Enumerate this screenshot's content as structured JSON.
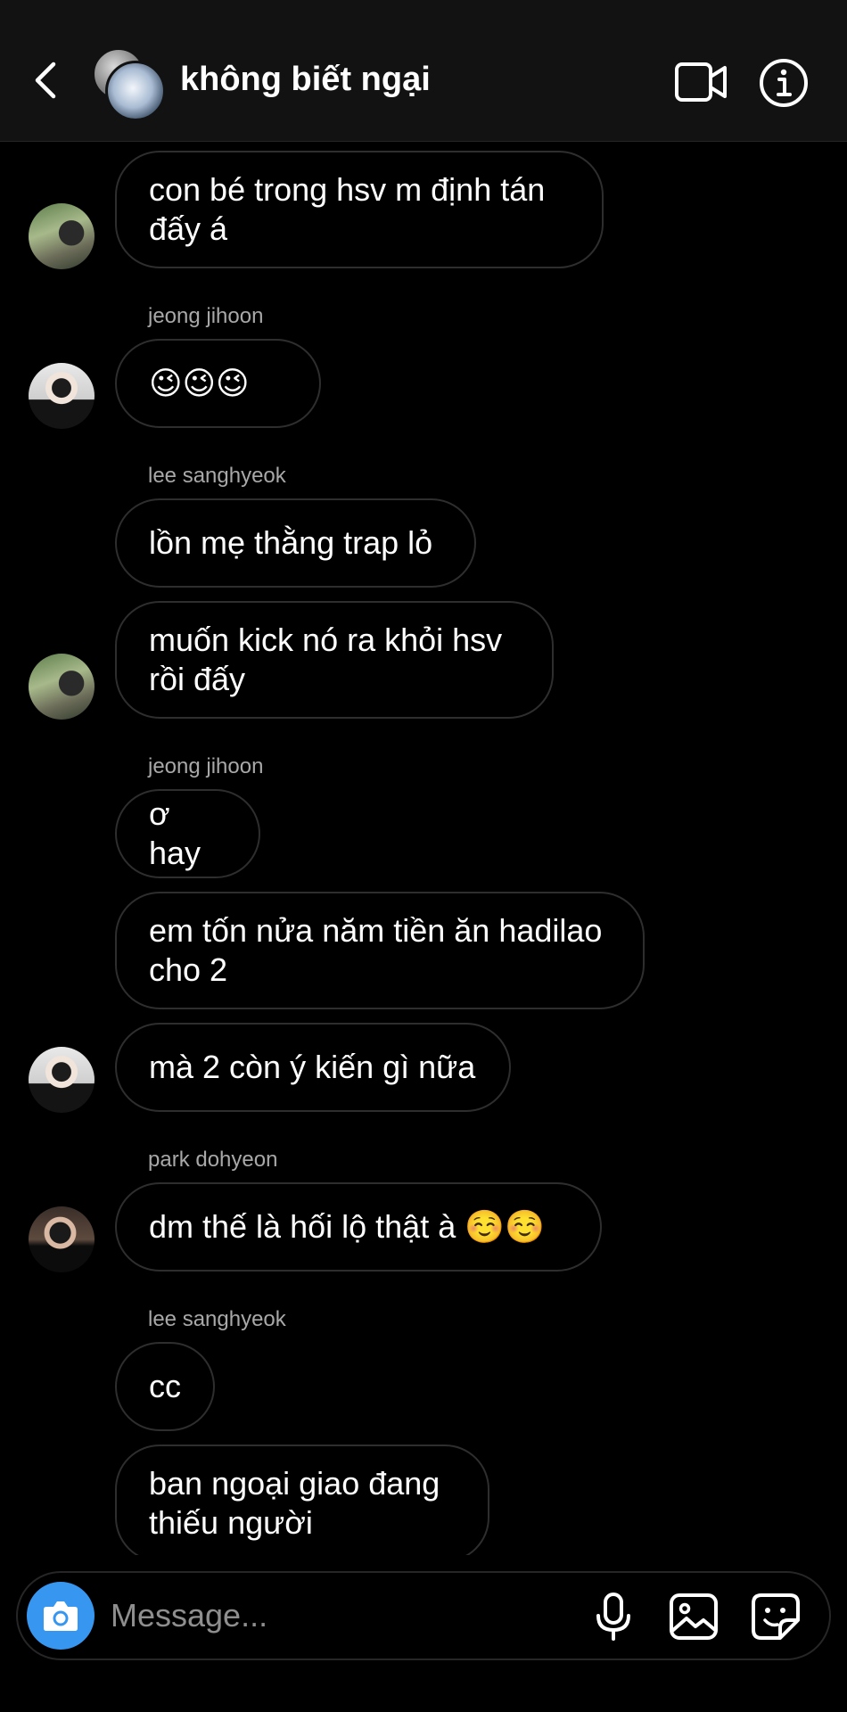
{
  "header": {
    "title": "không biết ngại",
    "back_icon": "chevron-left-icon",
    "video_icon": "video-camera-icon",
    "info_icon": "info-icon"
  },
  "messages": [
    {
      "sender": "",
      "text": "con bé trong hsv m định tán đấy á"
    },
    {
      "sender": "jeong jihoon",
      "text": "😉😉😉"
    },
    {
      "sender": "lee sanghyeok",
      "text": "lồn mẹ thằng trap lỏ"
    },
    {
      "sender": "",
      "text": "muốn kick nó ra khỏi hsv rồi đấy"
    },
    {
      "sender": "jeong jihoon",
      "text": "ơ hay"
    },
    {
      "sender": "",
      "text": "em tốn nửa năm tiền ăn hadilao cho 2"
    },
    {
      "sender": "",
      "text": "mà 2 còn ý kiến gì nữa"
    },
    {
      "sender": "park dohyeon",
      "text": "dm thế là hối lộ thật à ☺️☺️"
    },
    {
      "sender": "lee sanghyeok",
      "text": "cc"
    },
    {
      "sender": "",
      "text": "ban ngoại giao đang thiếu người"
    }
  ],
  "composer": {
    "placeholder": "Message...",
    "value": "",
    "camera_icon": "camera-icon",
    "mic_icon": "microphone-icon",
    "gallery_icon": "image-icon",
    "sticker_icon": "sticker-icon"
  },
  "colors": {
    "background": "#000000",
    "header_bg": "#121212",
    "bubble_border": "#2e2e2e",
    "sender_text": "#a8a8a8",
    "accent": "#3797f0"
  }
}
